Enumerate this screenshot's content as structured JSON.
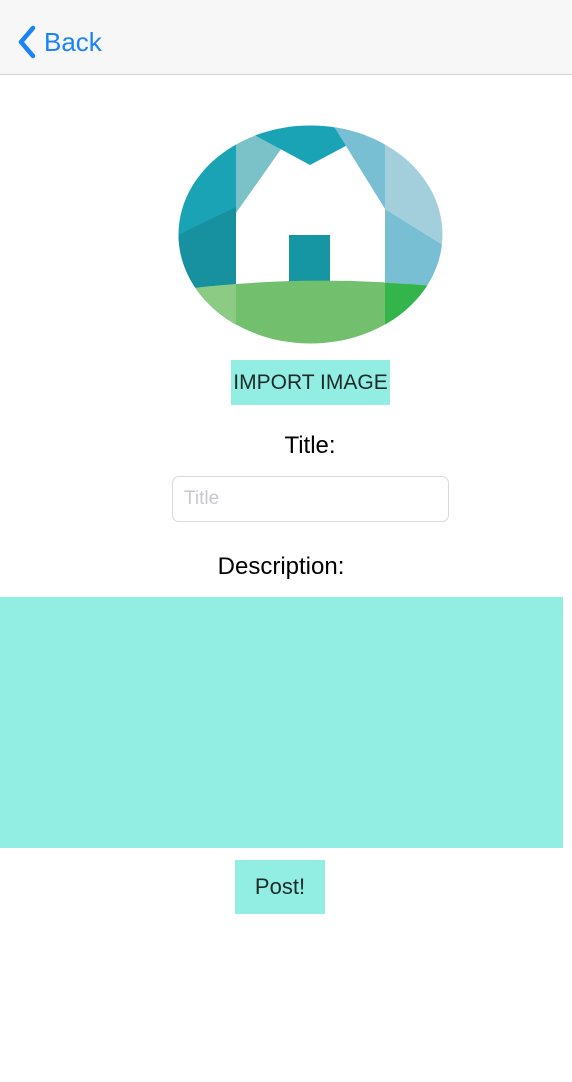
{
  "nav": {
    "back_label": "Back",
    "back_icon": "chevron-left-icon",
    "accent_color": "#1a82fb"
  },
  "logo": {
    "icon": "house-logo-icon",
    "colors": {
      "teal": "#1aa3b5",
      "light_blue": "#7bc1d6",
      "green": "#72bf6e",
      "bright_green": "#34b54c"
    }
  },
  "import_button": {
    "label": "IMPORT IMAGE"
  },
  "title_field": {
    "label": "Title:",
    "placeholder": "Title",
    "value": ""
  },
  "description_field": {
    "label": "Description:",
    "value": ""
  },
  "post_button": {
    "label": "Post!"
  },
  "theme": {
    "button_fill": "#92ede3"
  }
}
